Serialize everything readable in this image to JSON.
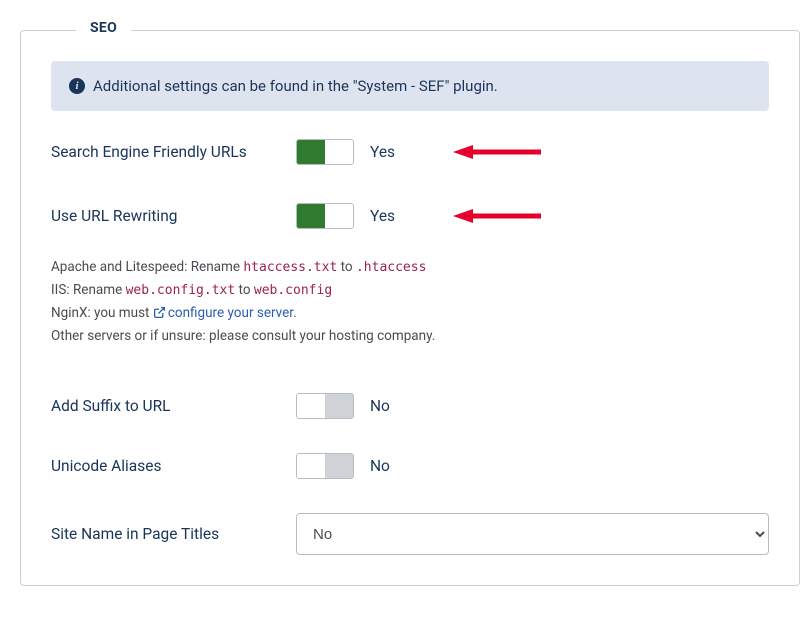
{
  "panel": {
    "title": "SEO"
  },
  "alert": {
    "text": "Additional settings can be found in the \"System - SEF\" plugin."
  },
  "fields": {
    "sef": {
      "label": "Search Engine Friendly URLs",
      "value": "Yes",
      "on": true
    },
    "rewrite": {
      "label": "Use URL Rewriting",
      "value": "Yes",
      "on": true
    },
    "suffix": {
      "label": "Add Suffix to URL",
      "value": "No",
      "on": false
    },
    "unicode": {
      "label": "Unicode Aliases",
      "value": "No",
      "on": false
    },
    "sitename": {
      "label": "Site Name in Page Titles",
      "value": "No"
    }
  },
  "hints": {
    "apache_pre": "Apache and Litespeed: Rename ",
    "apache_file1": "htaccess.txt",
    "apache_mid": " to ",
    "apache_file2": ".htaccess",
    "iis_pre": "IIS: Rename ",
    "iis_file1": "web.config.txt",
    "iis_mid": " to ",
    "iis_file2": "web.config",
    "nginx_pre": "NginX: you must ",
    "nginx_link": "configure your server",
    "nginx_post": ".",
    "other": "Other servers or if unsure: please consult your hosting company."
  }
}
